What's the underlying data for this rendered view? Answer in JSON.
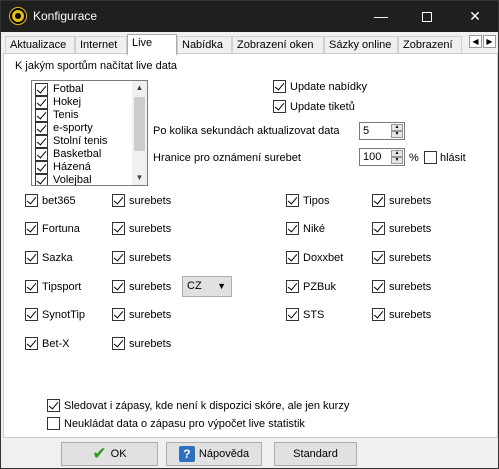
{
  "window": {
    "title": "Konfigurace"
  },
  "tabs": [
    "Aktualizace",
    "Internet",
    "Live",
    "Nabídka",
    "Zobrazení oken",
    "Sázky online",
    "Zobrazení"
  ],
  "live": {
    "sports_label": "K jakým sportům načítat live data",
    "sports": [
      "Fotbal",
      "Hokej",
      "Tenis",
      "e-sporty",
      "Stolní tenis",
      "Basketbal",
      "Házená",
      "Volejbal"
    ],
    "update_offers": "Update nabídky",
    "update_tickets": "Update tiketů",
    "refresh_label": "Po kolika sekundách aktualizovat data",
    "refresh_value": "5",
    "surebet_label": "Hranice pro oznámení surebet",
    "surebet_value": "100",
    "surebet_unit": "%",
    "report_label": "hlásit",
    "surebets_label": "surebets",
    "bookmakers_left": [
      "bet365",
      "Fortuna",
      "Sazka",
      "Tipsport",
      "SynotTip",
      "Bet-X"
    ],
    "bookmakers_right": [
      "Tipos",
      "Niké",
      "Doxxbet",
      "PZBuk",
      "STS"
    ],
    "tipsport_country": "CZ",
    "follow_no_score": "Sledovat i zápasy, kde není k dispozici skóre, ale jen kurzy",
    "no_save_stats": "Neukládat data o zápasu pro výpočet live statistik"
  },
  "buttons": {
    "ok": "OK",
    "help": "Nápověda",
    "standard": "Standard"
  },
  "colors": {
    "titlebar": "#1f1f1f",
    "ok_check": "#2a9a1a",
    "help_icon": "#2f6fc0"
  }
}
